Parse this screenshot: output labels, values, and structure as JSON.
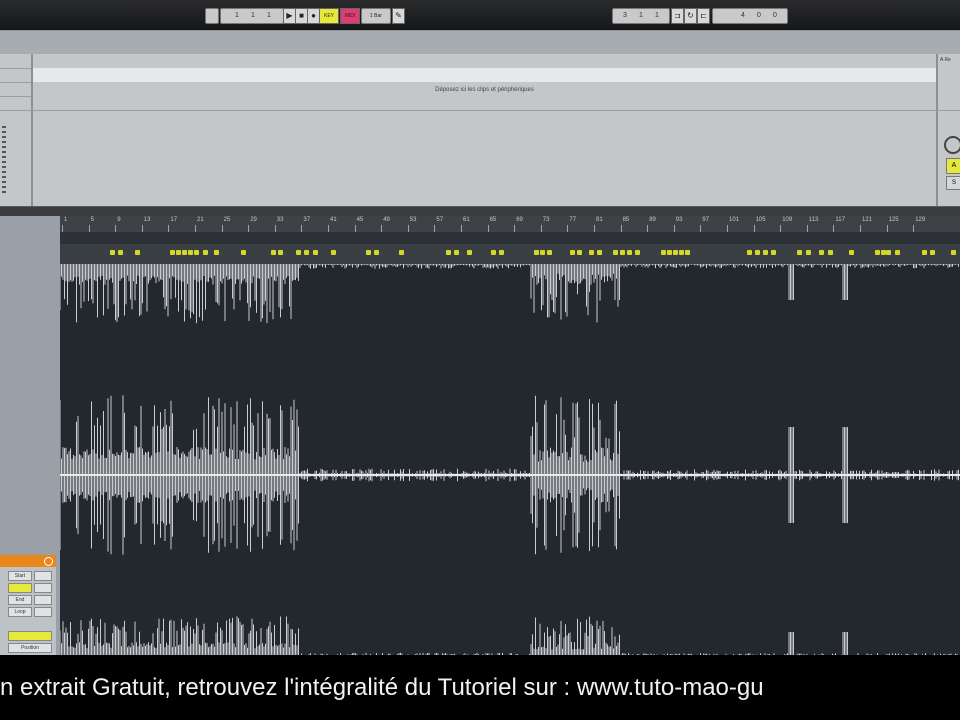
{
  "transport": {
    "bar_position": [
      "1",
      "1",
      "1"
    ],
    "key_label": "KEY",
    "midi_label": "MIDI",
    "cpu_label": "1 Bar",
    "right_numbers": [
      "3",
      "1",
      "1"
    ],
    "right_numbers2": [
      "4",
      "0",
      "0"
    ]
  },
  "session": {
    "drop_text": "Déposez ici les clips et périphériques",
    "right_header": "A Re"
  },
  "arrangement": {
    "ruler_labels": [
      "1",
      "5",
      "9",
      "13",
      "17",
      "21",
      "25",
      "29",
      "33",
      "37",
      "41",
      "45",
      "49",
      "53",
      "57",
      "61",
      "65",
      "69",
      "73",
      "77",
      "81",
      "85",
      "89",
      "93",
      "97",
      "101",
      "105",
      "109",
      "113",
      "117",
      "121",
      "125",
      "129"
    ],
    "accent_color": "#d6d72b",
    "waveform_color": "#e8eaec"
  },
  "clip_panel": {
    "header_color": "#e8871c",
    "fields": [
      "Start",
      "End",
      "Loop",
      "Position"
    ]
  },
  "caption": {
    "text": "n extrait Gratuit, retrouvez l'intégralité du Tutoriel sur :    www.tuto-mao-gu"
  }
}
